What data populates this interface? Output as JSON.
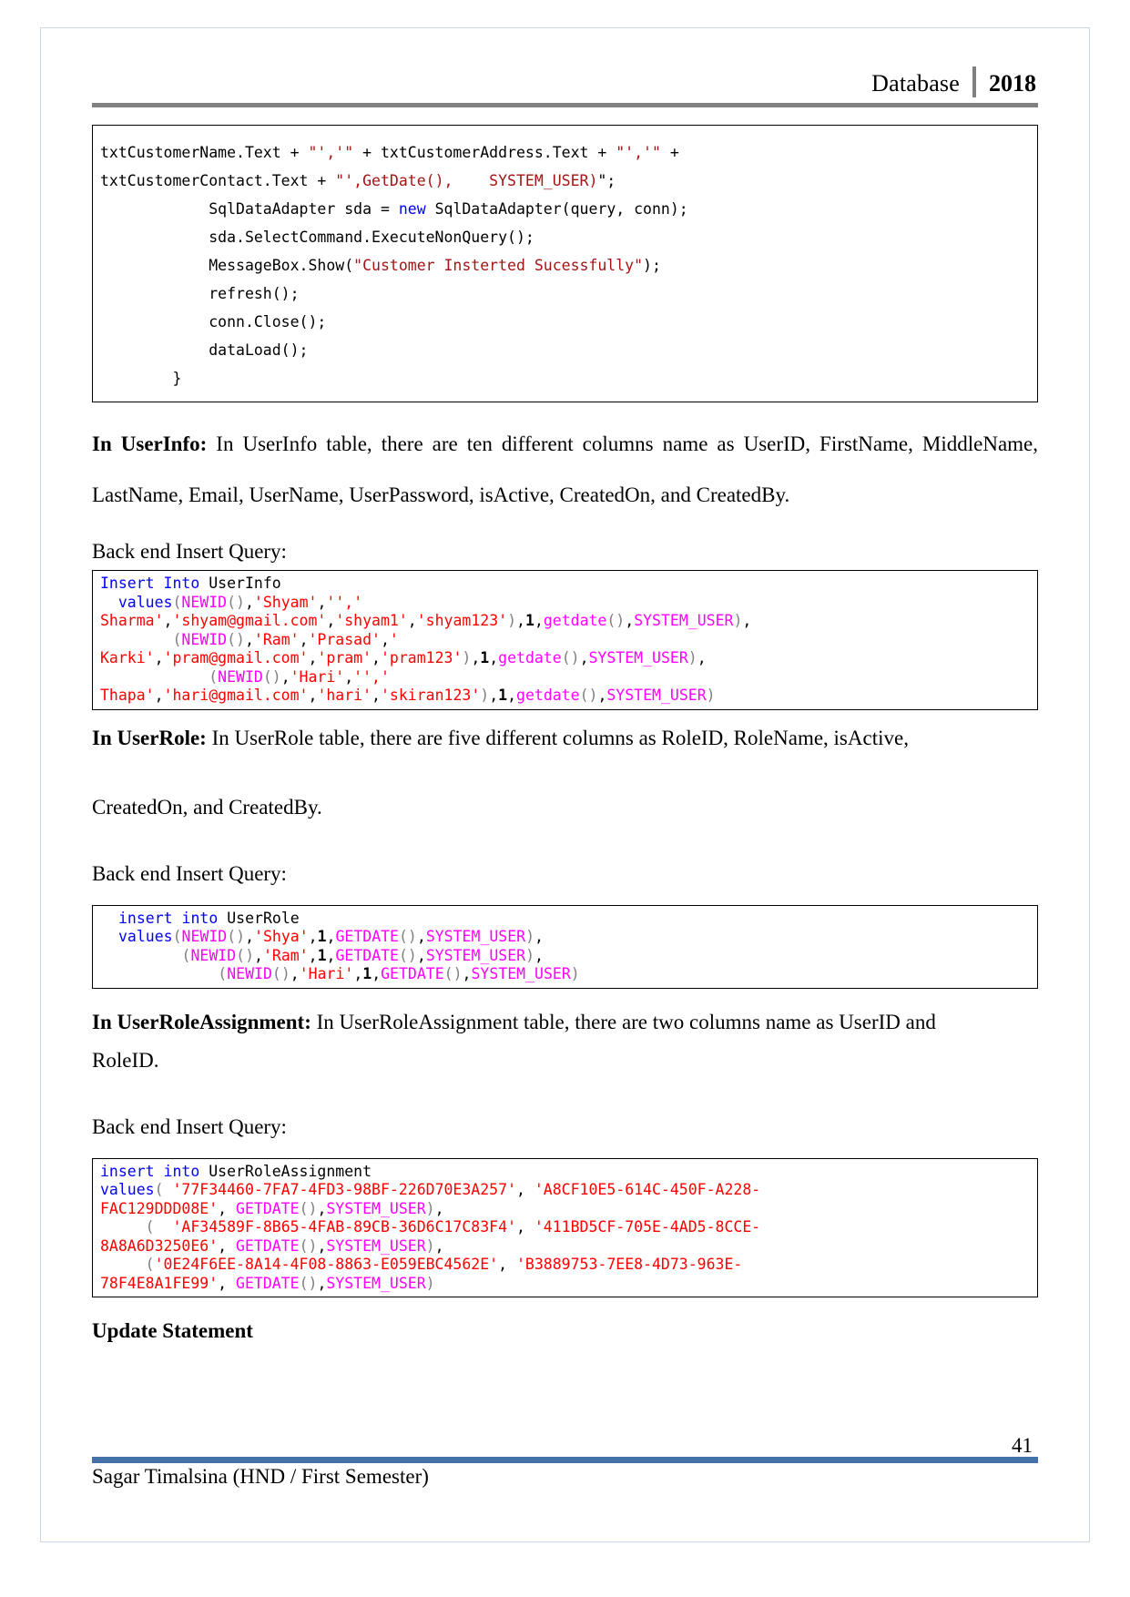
{
  "header": {
    "subject": "Database",
    "year": "2018",
    "divider_color": "#808080"
  },
  "code_csharp": {
    "lines": [
      [
        {
          "t": "txtCustomerName.Text + ",
          "c": "plain"
        },
        {
          "t": "\"','\"",
          "c": "str"
        },
        {
          "t": " + txtCustomerAddress.Text + ",
          "c": "plain"
        },
        {
          "t": "\"','\"",
          "c": "str"
        },
        {
          "t": " +",
          "c": "plain"
        }
      ],
      [
        {
          "t": "txtCustomerContact.Text + ",
          "c": "plain"
        },
        {
          "t": "\"',",
          "c": "str"
        },
        {
          "t": "GetDate(),    SYSTEM_USER)",
          "c": "str"
        },
        {
          "t": "\";",
          "c": "plain"
        }
      ],
      [
        {
          "t": "            SqlDataAdapter sda = ",
          "c": "plain"
        },
        {
          "t": "new",
          "c": "kw-cs"
        },
        {
          "t": " SqlDataAdapter(query, conn);",
          "c": "plain"
        }
      ],
      [
        {
          "t": "            sda.SelectCommand.ExecuteNonQuery();",
          "c": "plain"
        }
      ],
      [
        {
          "t": "            MessageBox.Show(",
          "c": "plain"
        },
        {
          "t": "\"Customer Insterted Sucessfully\"",
          "c": "str"
        },
        {
          "t": ");",
          "c": "plain"
        }
      ],
      [
        {
          "t": "            refresh();",
          "c": "plain"
        }
      ],
      [
        {
          "t": "            conn.Close();",
          "c": "plain"
        }
      ],
      [
        {
          "t": "            dataLoad();",
          "c": "plain"
        }
      ],
      [
        {
          "t": "        }",
          "c": "plain"
        }
      ]
    ]
  },
  "userinfo": {
    "heading": "In  UserInfo:",
    "paragraph": " In  UserInfo  table,  there  are  ten  different  columns  name  as  UserID,  FirstName, MiddleName, LastName, Email, UserName, UserPassword, isActive, CreatedOn, and CreatedBy.",
    "query_label": "Back end Insert Query:",
    "lines": [
      [
        {
          "t": "Insert Into",
          "c": "kw"
        },
        {
          "t": " UserInfo",
          "c": "plain"
        }
      ],
      [
        {
          "t": "  ",
          "c": "plain"
        },
        {
          "t": "values",
          "c": "kw"
        },
        {
          "t": "(",
          "c": "punct"
        },
        {
          "t": "NEWID",
          "c": "fn"
        },
        {
          "t": "()",
          "c": "punct"
        },
        {
          "t": ",",
          "c": "plain"
        },
        {
          "t": "'Shyam'",
          "c": "str-sql"
        },
        {
          "t": ",",
          "c": "plain"
        },
        {
          "t": "'',",
          "c": "str-sql"
        },
        {
          "t": "'",
          "c": "str-sql"
        }
      ],
      [
        {
          "t": "Sharma'",
          "c": "str-sql"
        },
        {
          "t": ",",
          "c": "plain"
        },
        {
          "t": "'shyam@gmail.com'",
          "c": "str-sql"
        },
        {
          "t": ",",
          "c": "plain"
        },
        {
          "t": "'shyam1'",
          "c": "str-sql"
        },
        {
          "t": ",",
          "c": "plain"
        },
        {
          "t": "'shyam123'",
          "c": "str-sql"
        },
        {
          "t": ")",
          "c": "punct"
        },
        {
          "t": ",",
          "c": "plain"
        },
        {
          "t": "1",
          "c": "num"
        },
        {
          "t": ",",
          "c": "plain"
        },
        {
          "t": "getdate",
          "c": "fn"
        },
        {
          "t": "()",
          "c": "punct"
        },
        {
          "t": ",",
          "c": "plain"
        },
        {
          "t": "SYSTEM_USER",
          "c": "fn"
        },
        {
          "t": ")",
          "c": "punct"
        },
        {
          "t": ",",
          "c": "plain"
        }
      ],
      [
        {
          "t": "        (",
          "c": "punct"
        },
        {
          "t": "NEWID",
          "c": "fn"
        },
        {
          "t": "()",
          "c": "punct"
        },
        {
          "t": ",",
          "c": "plain"
        },
        {
          "t": "'Ram'",
          "c": "str-sql"
        },
        {
          "t": ",",
          "c": "plain"
        },
        {
          "t": "'Prasad'",
          "c": "str-sql"
        },
        {
          "t": ",",
          "c": "plain"
        },
        {
          "t": "'",
          "c": "str-sql"
        }
      ],
      [
        {
          "t": "Karki'",
          "c": "str-sql"
        },
        {
          "t": ",",
          "c": "plain"
        },
        {
          "t": "'pram@gmail.com'",
          "c": "str-sql"
        },
        {
          "t": ",",
          "c": "plain"
        },
        {
          "t": "'pram'",
          "c": "str-sql"
        },
        {
          "t": ",",
          "c": "plain"
        },
        {
          "t": "'pram123'",
          "c": "str-sql"
        },
        {
          "t": ")",
          "c": "punct"
        },
        {
          "t": ",",
          "c": "plain"
        },
        {
          "t": "1",
          "c": "num"
        },
        {
          "t": ",",
          "c": "plain"
        },
        {
          "t": "getdate",
          "c": "fn"
        },
        {
          "t": "()",
          "c": "punct"
        },
        {
          "t": ",",
          "c": "plain"
        },
        {
          "t": "SYSTEM_USER",
          "c": "fn"
        },
        {
          "t": ")",
          "c": "punct"
        },
        {
          "t": ",",
          "c": "plain"
        }
      ],
      [
        {
          "t": "            (",
          "c": "punct"
        },
        {
          "t": "NEWID",
          "c": "fn"
        },
        {
          "t": "()",
          "c": "punct"
        },
        {
          "t": ",",
          "c": "plain"
        },
        {
          "t": "'Hari'",
          "c": "str-sql"
        },
        {
          "t": ",",
          "c": "plain"
        },
        {
          "t": "'',",
          "c": "str-sql"
        },
        {
          "t": "'",
          "c": "str-sql"
        }
      ],
      [
        {
          "t": "Thapa'",
          "c": "str-sql"
        },
        {
          "t": ",",
          "c": "plain"
        },
        {
          "t": "'hari@gmail.com'",
          "c": "str-sql"
        },
        {
          "t": ",",
          "c": "plain"
        },
        {
          "t": "'hari'",
          "c": "str-sql"
        },
        {
          "t": ",",
          "c": "plain"
        },
        {
          "t": "'skiran123'",
          "c": "str-sql"
        },
        {
          "t": ")",
          "c": "punct"
        },
        {
          "t": ",",
          "c": "plain"
        },
        {
          "t": "1",
          "c": "num"
        },
        {
          "t": ",",
          "c": "plain"
        },
        {
          "t": "getdate",
          "c": "fn"
        },
        {
          "t": "()",
          "c": "punct"
        },
        {
          "t": ",",
          "c": "plain"
        },
        {
          "t": "SYSTEM_USER",
          "c": "fn"
        },
        {
          "t": ")",
          "c": "punct"
        }
      ]
    ]
  },
  "userrole": {
    "heading": "In UserRole:",
    "paragraph_line1": " In UserRole table, there are five different columns as RoleID, RoleName, isActive,",
    "paragraph_line2": "CreatedOn, and CreatedBy.",
    "query_label": "Back end Insert Query:",
    "lines": [
      [
        {
          "t": "insert into",
          "c": "kw"
        },
        {
          "t": " UserRole",
          "c": "plain"
        }
      ],
      [
        {
          "t": "values",
          "c": "kw"
        },
        {
          "t": "(",
          "c": "punct"
        },
        {
          "t": "NEWID",
          "c": "fn"
        },
        {
          "t": "()",
          "c": "punct"
        },
        {
          "t": ",",
          "c": "plain"
        },
        {
          "t": "'Shya'",
          "c": "str-sql"
        },
        {
          "t": ",",
          "c": "plain"
        },
        {
          "t": "1",
          "c": "num"
        },
        {
          "t": ",",
          "c": "plain"
        },
        {
          "t": "GETDATE",
          "c": "fn"
        },
        {
          "t": "()",
          "c": "punct"
        },
        {
          "t": ",",
          "c": "plain"
        },
        {
          "t": "SYSTEM_USER",
          "c": "fn"
        },
        {
          "t": ")",
          "c": "punct"
        },
        {
          "t": ",",
          "c": "plain"
        }
      ],
      [
        {
          "t": "       (",
          "c": "punct"
        },
        {
          "t": "NEWID",
          "c": "fn"
        },
        {
          "t": "()",
          "c": "punct"
        },
        {
          "t": ",",
          "c": "plain"
        },
        {
          "t": "'Ram'",
          "c": "str-sql"
        },
        {
          "t": ",",
          "c": "plain"
        },
        {
          "t": "1",
          "c": "num"
        },
        {
          "t": ",",
          "c": "plain"
        },
        {
          "t": "GETDATE",
          "c": "fn"
        },
        {
          "t": "()",
          "c": "punct"
        },
        {
          "t": ",",
          "c": "plain"
        },
        {
          "t": "SYSTEM_USER",
          "c": "fn"
        },
        {
          "t": ")",
          "c": "punct"
        },
        {
          "t": ",",
          "c": "plain"
        }
      ],
      [
        {
          "t": "           (",
          "c": "punct"
        },
        {
          "t": "NEWID",
          "c": "fn"
        },
        {
          "t": "()",
          "c": "punct"
        },
        {
          "t": ",",
          "c": "plain"
        },
        {
          "t": "'Hari'",
          "c": "str-sql"
        },
        {
          "t": ",",
          "c": "plain"
        },
        {
          "t": "1",
          "c": "num"
        },
        {
          "t": ",",
          "c": "plain"
        },
        {
          "t": "GETDATE",
          "c": "fn"
        },
        {
          "t": "()",
          "c": "punct"
        },
        {
          "t": ",",
          "c": "plain"
        },
        {
          "t": "SYSTEM_USER",
          "c": "fn"
        },
        {
          "t": ")",
          "c": "punct"
        }
      ]
    ]
  },
  "userroleassignment": {
    "heading": "In UserRoleAssignment:",
    "paragraph_line1": " In UserRoleAssignment table, there are two columns name as UserID and",
    "paragraph_line2": "RoleID.",
    "query_label": "Back end Insert Query:",
    "lines": [
      [
        {
          "t": "insert into",
          "c": "kw"
        },
        {
          "t": " UserRoleAssignment",
          "c": "plain"
        }
      ],
      [
        {
          "t": "values",
          "c": "kw"
        },
        {
          "t": "( ",
          "c": "punct"
        },
        {
          "t": "'77F34460-7FA7-4FD3-98BF-226D70E3A257'",
          "c": "str-sql"
        },
        {
          "t": ", ",
          "c": "plain"
        },
        {
          "t": "'A8CF10E5-614C-450F-A228-",
          "c": "str-sql"
        }
      ],
      [
        {
          "t": "FAC129DDD08E'",
          "c": "str-sql"
        },
        {
          "t": ", ",
          "c": "plain"
        },
        {
          "t": "GETDATE",
          "c": "fn"
        },
        {
          "t": "()",
          "c": "punct"
        },
        {
          "t": ",",
          "c": "plain"
        },
        {
          "t": "SYSTEM_USER",
          "c": "fn"
        },
        {
          "t": ")",
          "c": "punct"
        },
        {
          "t": ",",
          "c": "plain"
        }
      ],
      [
        {
          "t": "     (  ",
          "c": "punct"
        },
        {
          "t": "'AF34589F-8B65-4FAB-89CB-36D6C17C83F4'",
          "c": "str-sql"
        },
        {
          "t": ", ",
          "c": "plain"
        },
        {
          "t": "'411BD5CF-705E-4AD5-8CCE-",
          "c": "str-sql"
        }
      ],
      [
        {
          "t": "8A8A6D3250E6'",
          "c": "str-sql"
        },
        {
          "t": ", ",
          "c": "plain"
        },
        {
          "t": "GETDATE",
          "c": "fn"
        },
        {
          "t": "()",
          "c": "punct"
        },
        {
          "t": ",",
          "c": "plain"
        },
        {
          "t": "SYSTEM_USER",
          "c": "fn"
        },
        {
          "t": ")",
          "c": "punct"
        },
        {
          "t": ",",
          "c": "plain"
        }
      ],
      [
        {
          "t": "     (",
          "c": "punct"
        },
        {
          "t": "'0E24F6EE-8A14-4F08-8863-E059EBC4562E'",
          "c": "str-sql"
        },
        {
          "t": ", ",
          "c": "plain"
        },
        {
          "t": "'B3889753-7EE8-4D73-963E-",
          "c": "str-sql"
        }
      ],
      [
        {
          "t": "78F4E8A1FE99'",
          "c": "str-sql"
        },
        {
          "t": ", ",
          "c": "plain"
        },
        {
          "t": "GETDATE",
          "c": "fn"
        },
        {
          "t": "()",
          "c": "punct"
        },
        {
          "t": ",",
          "c": "plain"
        },
        {
          "t": "SYSTEM_USER",
          "c": "fn"
        },
        {
          "t": ")",
          "c": "punct"
        }
      ]
    ]
  },
  "update_section": {
    "heading": "Update Statement"
  },
  "footer": {
    "author": "Sagar Timalsina (HND / First Semester)",
    "page_number": "41",
    "rule_color": "#4472a8"
  }
}
